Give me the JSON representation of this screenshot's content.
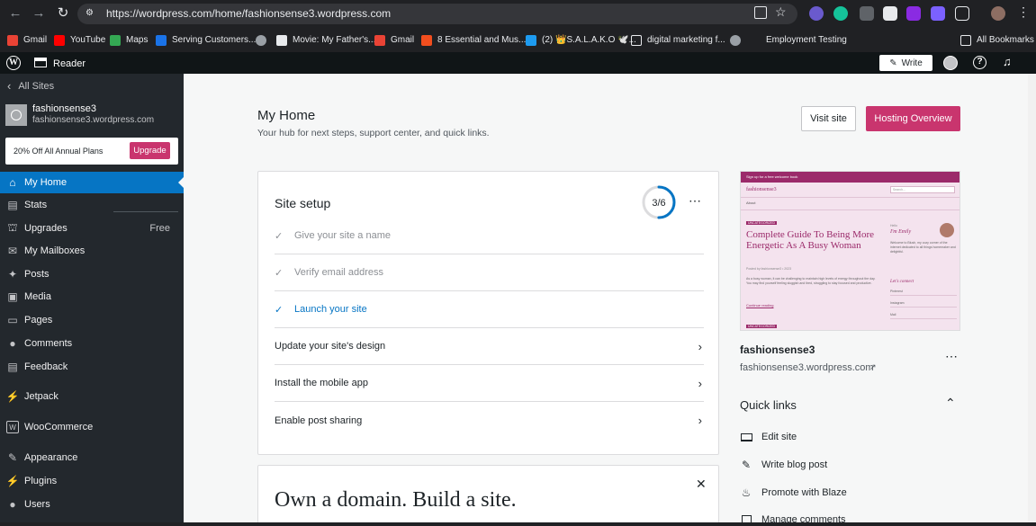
{
  "browser": {
    "url": "https://wordpress.com/home/fashionsense3.wordpress.com",
    "bookmarks": [
      {
        "label": "Gmail",
        "icon": "gmail-icon"
      },
      {
        "label": "YouTube",
        "icon": "youtube-icon"
      },
      {
        "label": "Maps",
        "icon": "maps-icon"
      },
      {
        "label": "Serving Customers...",
        "icon": "video-icon"
      },
      {
        "label": "",
        "icon": "globe-icon"
      },
      {
        "label": "Movie: My Father's...",
        "icon": "movie-icon"
      },
      {
        "label": "Gmail",
        "icon": "gmail-icon"
      },
      {
        "label": "8 Essential and Mus...",
        "icon": "figma-icon"
      },
      {
        "label": "(2) 👑S.A.L.A.K.O 🕊️...",
        "icon": "twitter-icon"
      },
      {
        "label": "digital marketing f...",
        "icon": "folder-icon"
      },
      {
        "label": "",
        "icon": "globe-icon"
      },
      {
        "label": "Employment Testing",
        "icon": "blank-icon"
      }
    ],
    "all_bookmarks": "All Bookmarks"
  },
  "topbar": {
    "reader": "Reader",
    "write": "Write"
  },
  "sidebar": {
    "all_sites": "All Sites",
    "site_name": "fashionsense3",
    "site_url": "fashionsense3.wordpress.com",
    "promo": "20% Off All Annual Plans",
    "upgrade": "Upgrade",
    "items": [
      {
        "label": "My Home",
        "icon": "home-icon",
        "badge": ""
      },
      {
        "label": "Stats",
        "icon": "stats-icon",
        "badge": ""
      },
      {
        "label": "Upgrades",
        "icon": "cart-icon",
        "badge": "Free"
      },
      {
        "label": "My Mailboxes",
        "icon": "mail-icon",
        "badge": ""
      },
      {
        "label": "Posts",
        "icon": "pin-icon",
        "badge": ""
      },
      {
        "label": "Media",
        "icon": "media-icon",
        "badge": ""
      },
      {
        "label": "Pages",
        "icon": "pages-icon",
        "badge": ""
      },
      {
        "label": "Comments",
        "icon": "comment-icon",
        "badge": ""
      },
      {
        "label": "Feedback",
        "icon": "feedback-icon",
        "badge": ""
      },
      {
        "label": "Jetpack",
        "icon": "jetpack-icon",
        "badge": ""
      },
      {
        "label": "WooCommerce",
        "icon": "woo-icon",
        "badge": ""
      },
      {
        "label": "Appearance",
        "icon": "brush-icon",
        "badge": ""
      },
      {
        "label": "Plugins",
        "icon": "plug-icon",
        "badge": ""
      },
      {
        "label": "Users",
        "icon": "user-icon",
        "badge": ""
      }
    ]
  },
  "main": {
    "title": "My Home",
    "subtitle": "Your hub for next steps, support center, and quick links.",
    "visit_site": "Visit site",
    "hosting_overview": "Hosting Overview",
    "setup": {
      "title": "Site setup",
      "progress": "3/6",
      "progress_fraction": 0.5,
      "tasks": [
        {
          "label": "Give your site a name",
          "state": "done"
        },
        {
          "label": "Verify email address",
          "state": "done"
        },
        {
          "label": "Launch your site",
          "state": "done-link"
        },
        {
          "label": "Update your site's design",
          "state": "todo"
        },
        {
          "label": "Install the mobile app",
          "state": "todo"
        },
        {
          "label": "Enable post sharing",
          "state": "todo"
        }
      ]
    },
    "domain_headline": "Own a domain. Build a site.",
    "preview": {
      "banner": "Sign up for a free welcome book",
      "site_logo": "fashionsense3",
      "search": "Search...",
      "nav": "About",
      "category": "UNCATEGORIZED",
      "post_title": "Complete Guide To Being More Energetic As A Busy Woman",
      "post_meta": "Posted by fashionsense3 • 2023",
      "excerpt": "As a busy woman, it can be challenging to maintain high levels of energy throughout the day. You may find yourself feeling sluggish and tired, struggling to stay focused and productive.",
      "continue": "Continue reading",
      "category2": "UNCATEGORIZED",
      "hi": "Hello",
      "author": "I'm Emily",
      "bio": "Welcome to Blush, my cozy corner of the internet dedicated to all things homemaker and delightful.",
      "connect": "Let's connect",
      "social": [
        "Pinterest",
        "Instagram",
        "Mail"
      ]
    },
    "site_card": {
      "name": "fashionsense3",
      "url": "fashionsense3.wordpress.com"
    },
    "quick_links": {
      "title": "Quick links",
      "items": [
        {
          "label": "Edit site",
          "icon": "laptop-icon"
        },
        {
          "label": "Write blog post",
          "icon": "pencil-icon"
        },
        {
          "label": "Promote with Blaze",
          "icon": "flame-icon"
        },
        {
          "label": "Manage comments",
          "icon": "checkbox-icon"
        }
      ]
    }
  }
}
